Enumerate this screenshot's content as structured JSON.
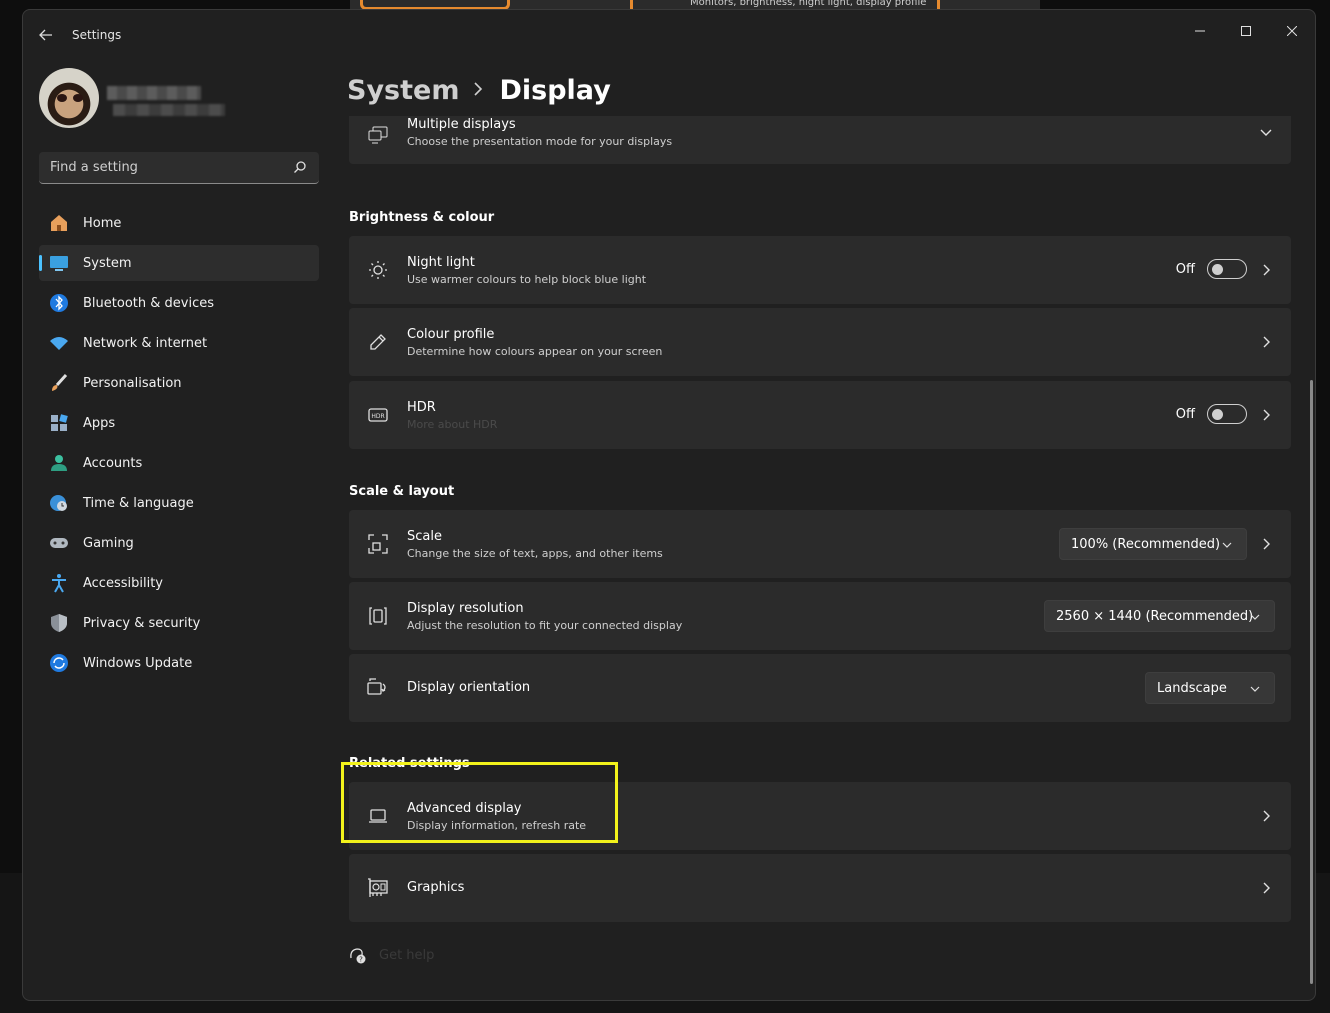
{
  "background": {
    "peek_text": "Monitors, brightness, night light, display profile"
  },
  "window": {
    "title": "Settings"
  },
  "sidebar": {
    "search": {
      "placeholder": "Find a setting"
    },
    "items": [
      {
        "label": "Home",
        "icon": "home-icon",
        "active": false
      },
      {
        "label": "System",
        "icon": "system-icon",
        "active": true
      },
      {
        "label": "Bluetooth & devices",
        "icon": "bluetooth-icon",
        "active": false
      },
      {
        "label": "Network & internet",
        "icon": "wifi-icon",
        "active": false
      },
      {
        "label": "Personalisation",
        "icon": "brush-icon",
        "active": false
      },
      {
        "label": "Apps",
        "icon": "apps-icon",
        "active": false
      },
      {
        "label": "Accounts",
        "icon": "account-icon",
        "active": false
      },
      {
        "label": "Time & language",
        "icon": "globe-clock-icon",
        "active": false
      },
      {
        "label": "Gaming",
        "icon": "gamepad-icon",
        "active": false
      },
      {
        "label": "Accessibility",
        "icon": "accessibility-icon",
        "active": false
      },
      {
        "label": "Privacy & security",
        "icon": "shield-icon",
        "active": false
      },
      {
        "label": "Windows Update",
        "icon": "update-icon",
        "active": false
      }
    ]
  },
  "breadcrumb": {
    "parent": "System",
    "current": "Display"
  },
  "main": {
    "multiple_displays": {
      "title": "Multiple displays",
      "desc": "Choose the presentation mode for your displays"
    },
    "brightness_section": "Brightness & colour",
    "night_light": {
      "title": "Night light",
      "desc": "Use warmer colours to help block blue light",
      "state": "Off"
    },
    "colour_profile": {
      "title": "Colour profile",
      "desc": "Determine how colours appear on your screen"
    },
    "hdr": {
      "title": "HDR",
      "link": "More about HDR",
      "state": "Off"
    },
    "scale_section": "Scale & layout",
    "scale": {
      "title": "Scale",
      "desc": "Change the size of text, apps, and other items",
      "value": "100% (Recommended)"
    },
    "resolution": {
      "title": "Display resolution",
      "desc": "Adjust the resolution to fit your connected display",
      "value": "2560 × 1440 (Recommended)"
    },
    "orientation": {
      "title": "Display orientation",
      "value": "Landscape"
    },
    "related_section": "Related settings",
    "advanced_display": {
      "title": "Advanced display",
      "desc": "Display information, refresh rate"
    },
    "graphics": {
      "title": "Graphics"
    },
    "get_help": "Get help"
  },
  "colors": {
    "accent": "#4cc2ff",
    "highlight": "#f2f21b",
    "window_bg": "#202020",
    "card_bg": "#2b2b2b"
  }
}
